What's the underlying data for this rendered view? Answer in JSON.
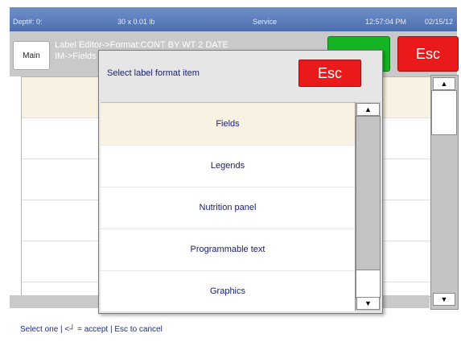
{
  "status_bar": {
    "dept": "Dept#: 0:",
    "weight": "30 x 0.01 lb",
    "mode": "Service",
    "time": "12:57:04 PM",
    "date": "02/15/12"
  },
  "header": {
    "main_label": "Main",
    "title_line1": "Label Editor->Format:CONT BY WT 2 DATE",
    "title_line2": "IM->Fields",
    "enter_label": "↵",
    "esc_label": "Esc"
  },
  "dialog": {
    "title": "Select label format item",
    "esc_label": "Esc",
    "options": [
      {
        "label": "Fields",
        "selected": true
      },
      {
        "label": "Legends",
        "selected": false
      },
      {
        "label": "Nutrition panel",
        "selected": false
      },
      {
        "label": "Programmable text",
        "selected": false
      },
      {
        "label": "Graphics",
        "selected": false
      }
    ],
    "scroll_up_icon": "▲",
    "scroll_down_icon": "▼"
  },
  "status_message": "Select one | <┘ = accept | Esc to cancel",
  "icons": [
    "up-arrow-icon",
    "down-arrow-icon",
    "enter-icon"
  ],
  "colors": {
    "top_bar": "#5b7dbd",
    "enter_button": "#13b523",
    "esc_button": "#ea1a1a",
    "selected_row": "#f9f2e2",
    "text": "#1b2070"
  }
}
